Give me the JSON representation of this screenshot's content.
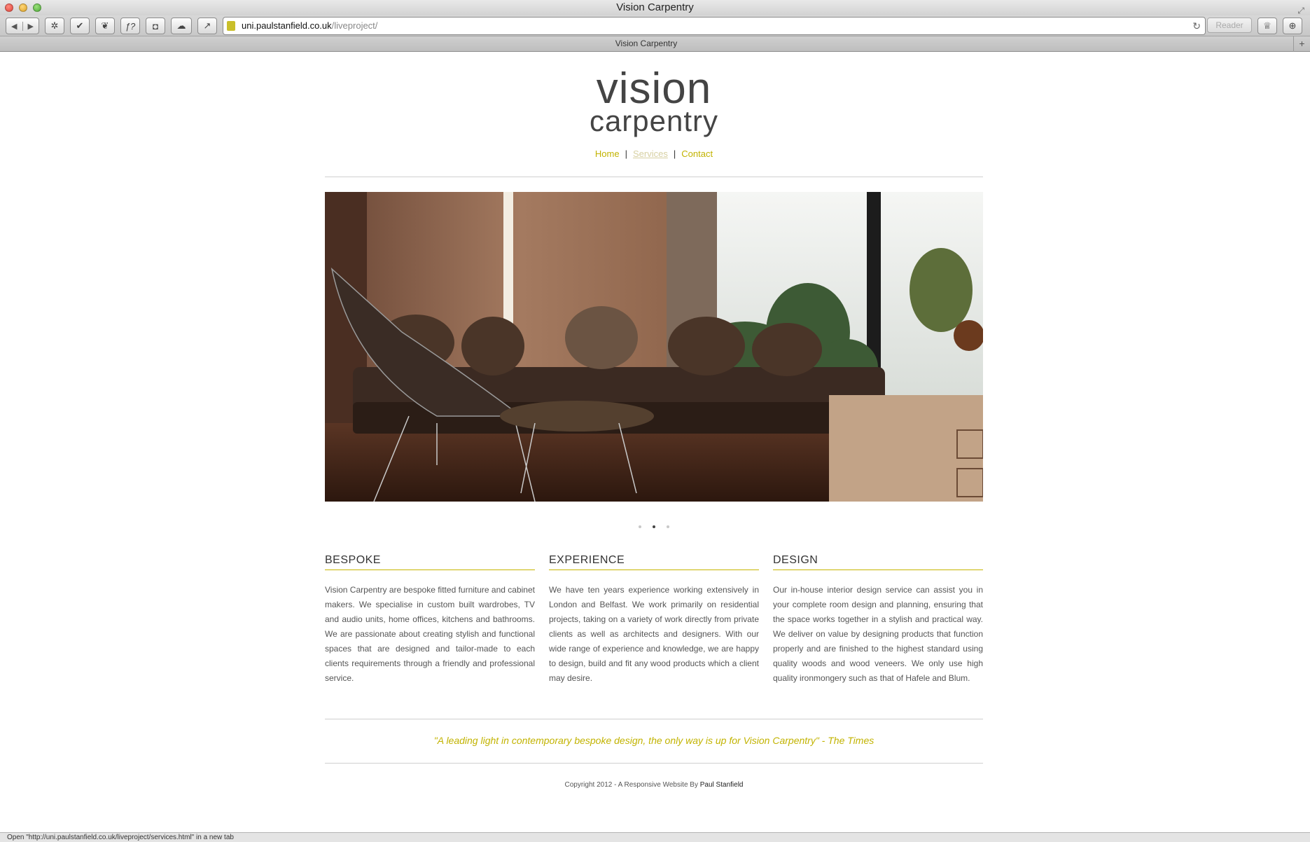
{
  "window": {
    "title": "Vision Carpentry"
  },
  "toolbar": {
    "url_host": "uni.paulstanfield.co.uk",
    "url_path": "/liveproject/",
    "reader_label": "Reader"
  },
  "tab": {
    "title": "Vision Carpentry"
  },
  "logo": {
    "line1": "vision",
    "line2": "carpentry"
  },
  "nav": {
    "items": [
      {
        "label": "Home"
      },
      {
        "label": "Services"
      },
      {
        "label": "Contact"
      }
    ],
    "active": "Services"
  },
  "slider": {
    "slide_count": 3,
    "active_index": 1
  },
  "columns": [
    {
      "heading": "BESPOKE",
      "body": "Vision Carpentry are bespoke fitted furniture and cabinet makers. We specialise in custom built wardrobes, TV and audio units, home offices, kitchens and bathrooms. We are passionate about creating stylish and functional spaces that are designed and tailor-made to each clients requirements through a friendly and professional service."
    },
    {
      "heading": "EXPERIENCE",
      "body": "We have ten years experience working extensively in London and Belfast. We work primarily on residential projects, taking on a variety of work directly from private clients as well as architects and designers. With our wide range of experience and knowledge, we are happy to design, build and fit any wood products which a client may desire."
    },
    {
      "heading": "DESIGN",
      "body": "Our in-house interior design service can assist you in your complete room design and planning, ensuring that the space works together in a stylish and practical way. We deliver on value by designing products that function properly and are finished to the highest standard using quality woods and wood veneers. We only use high quality ironmongery such as that of Hafele and Blum."
    }
  ],
  "quote": "\"A leading light in contemporary bespoke design, the only way is up for Vision Carpentry\" - The Times",
  "footer": {
    "text": "Copyright 2012 - A Responsive Website By ",
    "author": "Paul Stanfield"
  },
  "status": "Open \"http://uni.paulstanfield.co.uk/liveproject/services.html\" in a new tab",
  "colors": {
    "accent": "#c2b300",
    "text": "#444444",
    "rule": "#cfcfcf"
  },
  "icons": [
    "back-icon",
    "forward-icon",
    "bug-icon",
    "validator-icon",
    "leaf-icon",
    "function-icon",
    "pocket-icon",
    "cloud-icon",
    "share-icon",
    "reload-icon",
    "bookmarks-icon",
    "download-icon",
    "fullscreen-icon",
    "new-tab-icon"
  ]
}
